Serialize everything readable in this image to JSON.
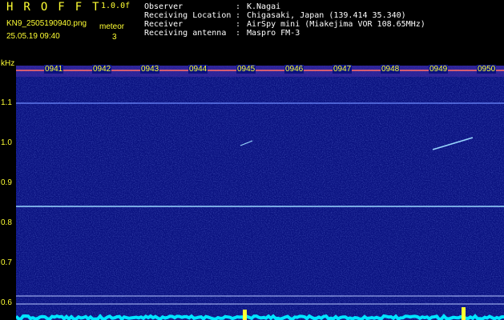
{
  "header": {
    "title": "HROFFT",
    "version": "1.0.0f",
    "filename": "KN9_2505190940.png",
    "datetime": "25.05.19 09:40",
    "meteor_label": "meteor",
    "meteor_count": "3"
  },
  "station": {
    "observer_label": "Observer",
    "observer": "K.Nagai",
    "location_label": "Receiving Location",
    "location": "Chigasaki, Japan (139.414 35.340)",
    "receiver_label": "Receiver",
    "receiver": "AirSpy mini (Miakejima VOR 108.65MHz)",
    "antenna_label": "Receiving antenna",
    "antenna": "Maspro FM-3",
    "separator": ":"
  },
  "axis": {
    "unit": "kHz",
    "y_ticks": [
      "1.1",
      "1.0",
      "0.9",
      "0.8",
      "0.7",
      "0.6"
    ],
    "time_ticks": [
      "0941",
      "0942",
      "0943",
      "0944",
      "0945",
      "0946",
      "0947",
      "0948",
      "0949",
      "0950"
    ]
  },
  "colors": {
    "background": "#000000",
    "spectrogram": "#0a1280",
    "label": "#ffff33",
    "signal": "#9ad8ff",
    "baseline": "#00e5ff"
  }
}
